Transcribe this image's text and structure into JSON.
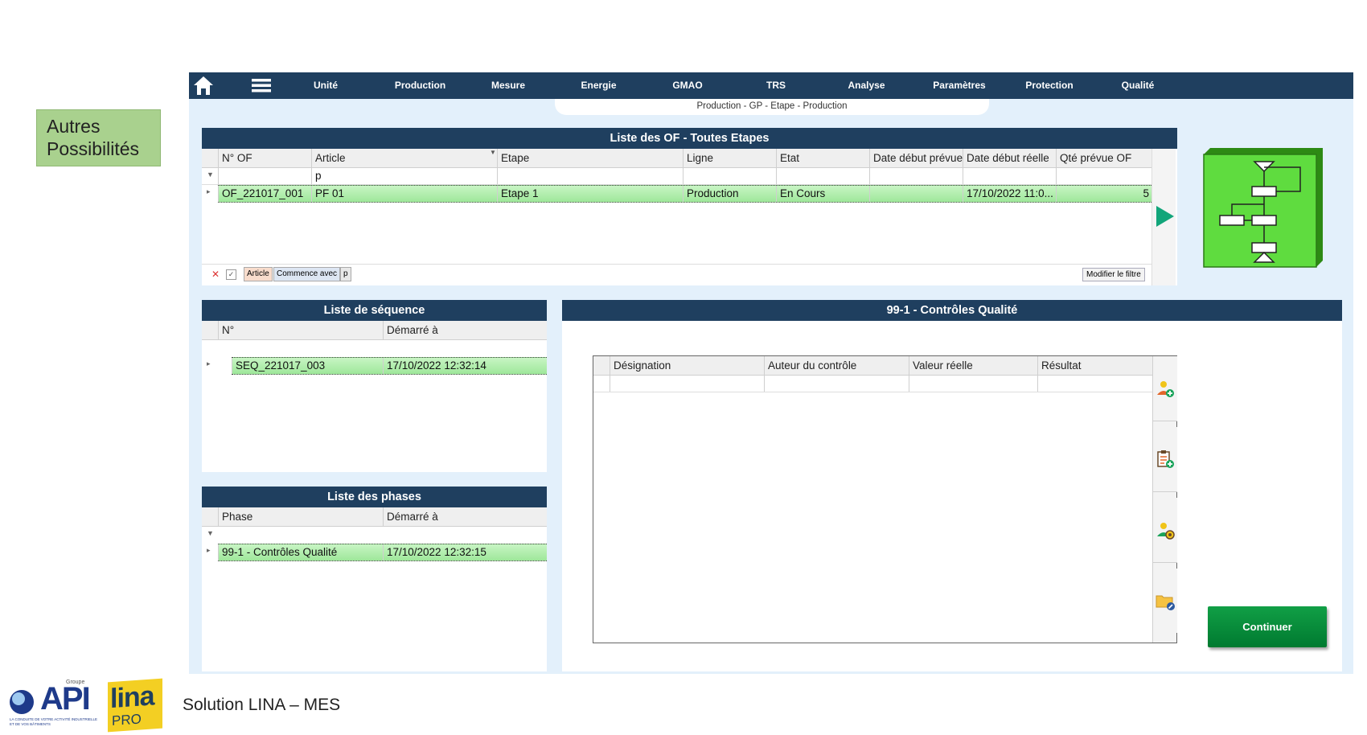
{
  "slide": {
    "label_line1": "Autres",
    "label_line2": "Possibilités",
    "footer_title": "Solution LINA – MES",
    "logo_api_text": "API",
    "logo_api_groupe": "Groupe",
    "logo_api_tagline": "LA CONDUITE DE VOTRE ACTIVITÉ INDUSTRIELLE ET DE VOS BÂTIMENTS",
    "logo_lina_text": "lina",
    "logo_lina_sub": "PRO"
  },
  "nav": {
    "home_icon": "home-icon",
    "menu_icon": "hamburger-menu-icon",
    "items": [
      "Unité",
      "Production",
      "Mesure",
      "Energie",
      "GMAO",
      "TRS",
      "Analyse",
      "Paramètres",
      "Protection",
      "Qualité"
    ]
  },
  "breadcrumb": "Production - GP - Etape - Production",
  "of_list": {
    "title": "Liste des OF - Toutes Etapes",
    "columns": [
      "N° OF",
      "Article",
      "Etape",
      "Ligne",
      "Etat",
      "Date début prévue",
      "Date début réelle",
      "Qté prévue OF"
    ],
    "filter_row": [
      "",
      "p",
      "",
      "",
      "",
      "",
      "",
      ""
    ],
    "rows": [
      [
        "OF_221017_001",
        "PF 01",
        "Etape 1",
        "Production",
        "En Cours",
        "",
        "17/10/2022 11:0...",
        "5"
      ]
    ],
    "filter_tags": [
      "Article",
      "Commence avec",
      "p"
    ],
    "modify_filter_label": "Modifier le filtre",
    "next_icon": "play-arrow-icon"
  },
  "sequence_list": {
    "title": "Liste de séquence",
    "columns": [
      "N°",
      "Démarré à"
    ],
    "rows": [
      [
        "SEQ_221017_003",
        "17/10/2022 12:32:14"
      ]
    ]
  },
  "phase_list": {
    "title": "Liste des phases",
    "columns": [
      "Phase",
      "Démarré à"
    ],
    "rows": [
      [
        "99-1 - Contrôles Qualité",
        "17/10/2022 12:32:15"
      ]
    ]
  },
  "quality": {
    "title": "99-1 - Contrôles Qualité",
    "columns": [
      "Désignation",
      "Auteur du contrôle",
      "Valeur réelle",
      "Résultat"
    ],
    "side_buttons": [
      "add-user-icon",
      "add-checklist-icon",
      "user-settings-icon",
      "folder-edit-icon"
    ],
    "continue_label": "Continuer"
  },
  "colors": {
    "navbar": "#1f3f5f",
    "app_bg": "#e3f0fb",
    "selected_row": "#a9eba5",
    "continue_button": "#0a8c3b",
    "workflow_icon": "#5fdc3f",
    "slide_label_bg": "#a9d18e"
  }
}
